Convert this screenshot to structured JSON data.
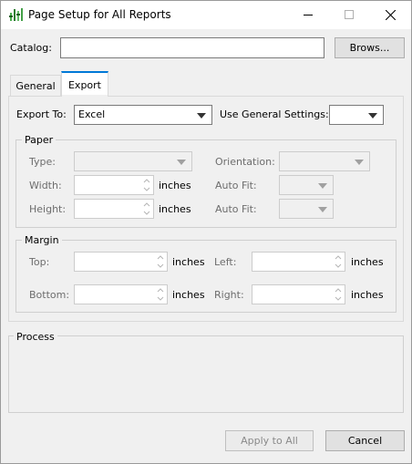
{
  "window": {
    "title": "Page Setup for All Reports",
    "minimize_icon": "minimize-icon",
    "maximize_icon": "maximize-icon",
    "close_icon": "close-icon"
  },
  "catalog": {
    "label": "Catalog:",
    "value": "",
    "browse_label": "Brows..."
  },
  "tabs": [
    {
      "label": "General",
      "active": false
    },
    {
      "label": "Export",
      "active": true
    }
  ],
  "export": {
    "export_to_label": "Export To:",
    "export_to_value": "Excel",
    "use_general_label": "Use General Settings:",
    "use_general_value": ""
  },
  "paper": {
    "title": "Paper",
    "type_label": "Type:",
    "orientation_label": "Orientation:",
    "width_label": "Width:",
    "height_label": "Height:",
    "inches": "inches",
    "autofit_label": "Auto Fit:"
  },
  "margin": {
    "title": "Margin",
    "top_label": "Top:",
    "bottom_label": "Bottom:",
    "left_label": "Left:",
    "right_label": "Right:",
    "inches": "inches"
  },
  "process": {
    "title": "Process"
  },
  "footer": {
    "apply_label": "Apply to All",
    "cancel_label": "Cancel"
  }
}
